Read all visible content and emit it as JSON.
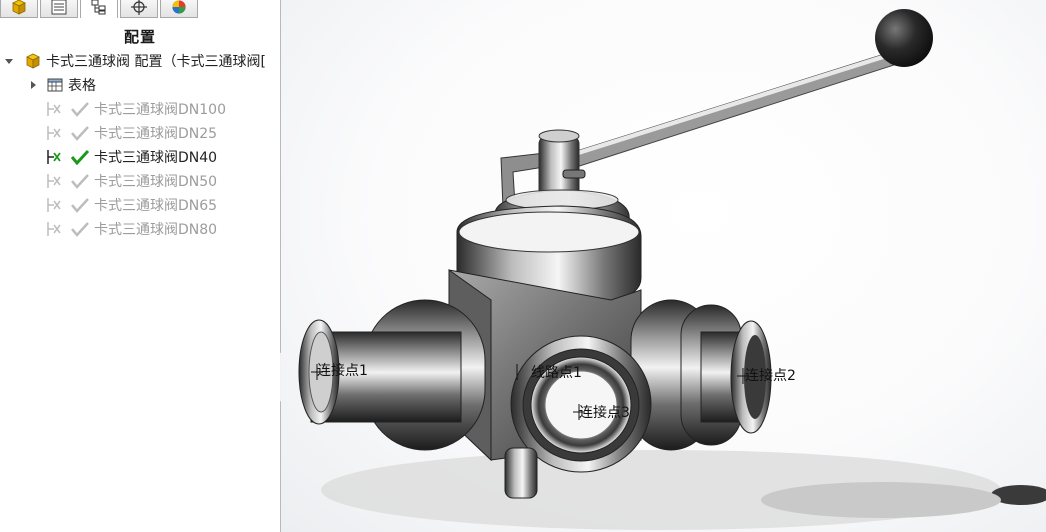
{
  "tabs": [
    {
      "icon": "feature-manager-icon"
    },
    {
      "icon": "property-manager-icon"
    },
    {
      "icon": "configuration-manager-icon",
      "active": true
    },
    {
      "icon": "dimxpert-icon"
    },
    {
      "icon": "display-manager-icon"
    }
  ],
  "panel": {
    "title": "配置"
  },
  "tree": {
    "root_label": "卡式三通球阀 配置（卡式三通球阀[",
    "table_label": "表格",
    "configurations": [
      {
        "label": "卡式三通球阀DN100",
        "active": false
      },
      {
        "label": "卡式三通球阀DN25",
        "active": false
      },
      {
        "label": "卡式三通球阀DN40",
        "active": true
      },
      {
        "label": "卡式三通球阀DN50",
        "active": false
      },
      {
        "label": "卡式三通球阀DN65",
        "active": false
      },
      {
        "label": "卡式三通球阀DN80",
        "active": false
      }
    ]
  },
  "viewport": {
    "connection_points": {
      "cp1": "连接点1",
      "cp2": "连接点2",
      "cp3": "连接点3",
      "route_point": "线路点1"
    }
  },
  "colors": {
    "check_active": "#1a9a1a",
    "check_inactive": "#bdbdbd",
    "part_icon": "#e6b000"
  }
}
